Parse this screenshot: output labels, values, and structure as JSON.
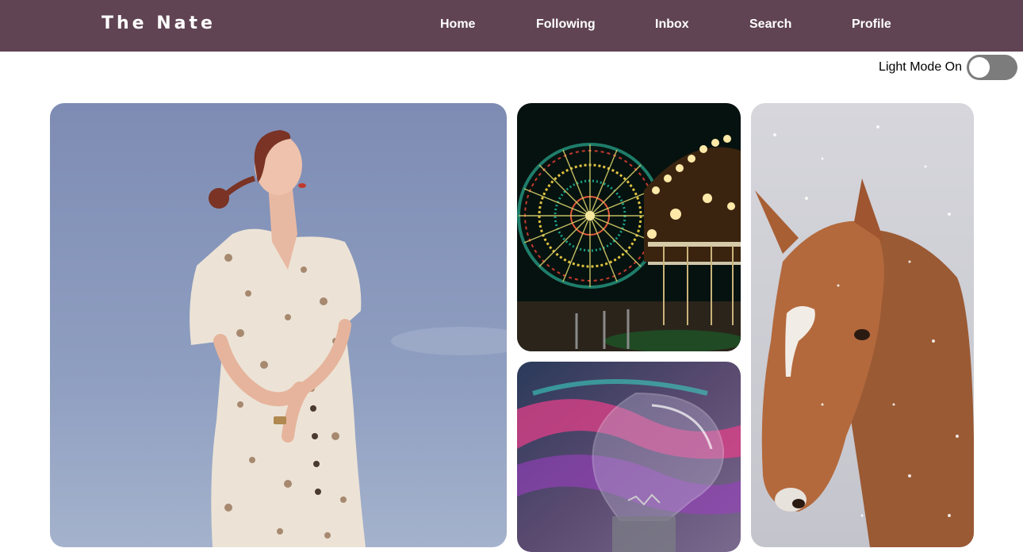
{
  "header": {
    "brand": "The Nate",
    "nav": [
      {
        "label": "Home"
      },
      {
        "label": "Following"
      },
      {
        "label": "Inbox"
      },
      {
        "label": "Search"
      },
      {
        "label": "Profile"
      }
    ]
  },
  "theme_toggle": {
    "label": "Light Mode On",
    "on": false
  },
  "gallery": {
    "images": [
      {
        "subject": "woman in floral dress against blue sky"
      },
      {
        "subject": "illuminated ferris wheel and carousel at night"
      },
      {
        "subject": "light bulb with pink and purple light trails"
      },
      {
        "subject": "chestnut horse with white blaze in snow"
      }
    ]
  },
  "colors": {
    "navbar": "#604453",
    "toggle_track": "#7c7c7c",
    "background": "#ffffff"
  }
}
